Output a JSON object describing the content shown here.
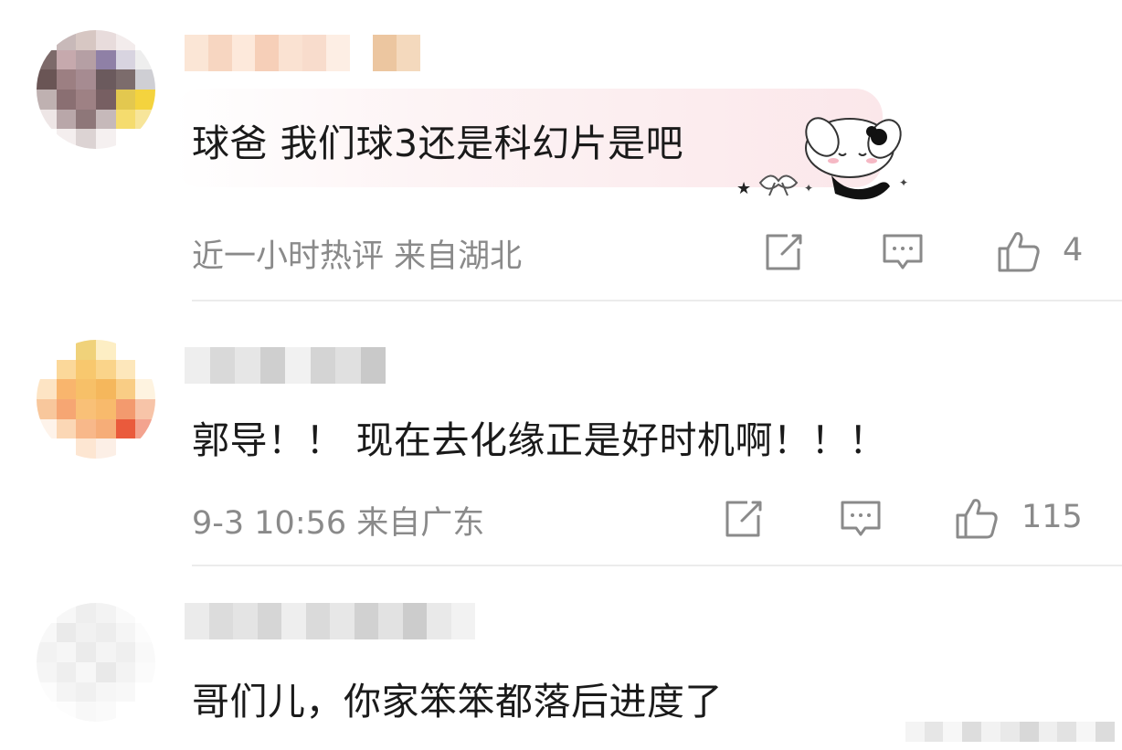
{
  "comments": [
    {
      "text": "球爸 我们球3还是科幻片是吧",
      "meta": "近一小时热评  来自湖北",
      "likes": "4",
      "has_sticker": true
    },
    {
      "text": "郭导！！ 现在去化缘正是好时机啊！！！",
      "meta": "9-3 10:56  来自广东",
      "likes": "115",
      "has_sticker": false
    },
    {
      "text": "哥们儿，你家笨笨都落后进度了",
      "meta": "",
      "likes": "",
      "has_sticker": false
    }
  ],
  "icons": {
    "share": "share-icon",
    "reply": "comment-icon",
    "like": "thumbs-up-icon"
  },
  "colors": {
    "meta_text": "#8a8a8a",
    "comment_text": "#1a1a1a",
    "divider": "#ececec",
    "bubble_pink": "#fbe7ea"
  }
}
